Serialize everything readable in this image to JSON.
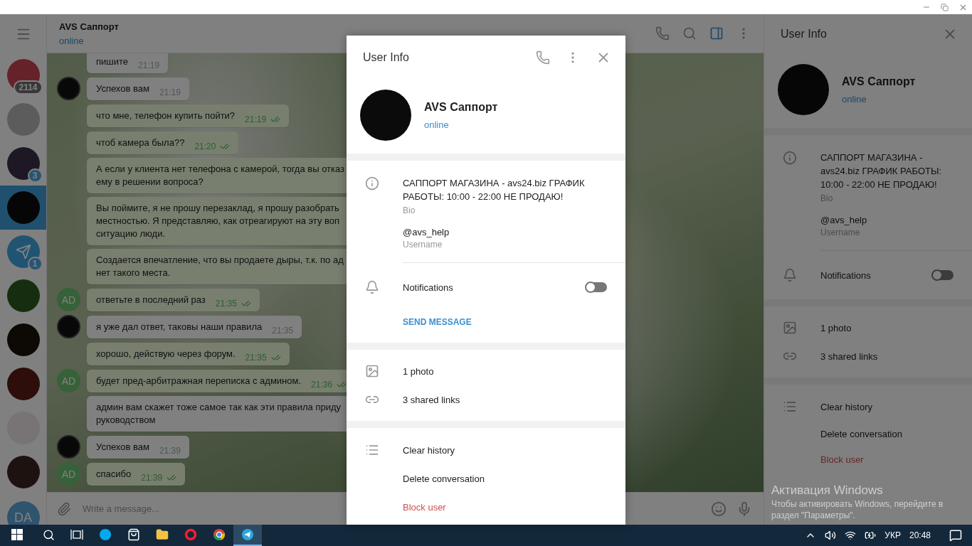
{
  "sidebar": {
    "chats": [
      {
        "kind": "photo",
        "badge": "2114",
        "muted": true,
        "selected": false
      },
      {
        "kind": "photo",
        "selected": false
      },
      {
        "kind": "photo",
        "badge": "3",
        "muted": false,
        "selected": false
      },
      {
        "kind": "photo",
        "selected": true
      },
      {
        "kind": "telegram",
        "badge": "1",
        "muted": false,
        "selected": false
      },
      {
        "kind": "photo",
        "selected": false
      },
      {
        "kind": "photo",
        "selected": false
      },
      {
        "kind": "photo",
        "selected": false
      },
      {
        "kind": "photo",
        "selected": false
      },
      {
        "kind": "photo",
        "selected": false
      }
    ],
    "account": {
      "initials": "DA"
    }
  },
  "chat": {
    "title": "AVS Саппорт",
    "status": "online",
    "header_icons": [
      {
        "kind": "phone",
        "active": false
      },
      {
        "kind": "search",
        "active": false
      },
      {
        "kind": "panel",
        "active": true
      },
      {
        "kind": "more",
        "active": false
      }
    ],
    "messages": [
      {
        "kind": "incoming",
        "lines": [
          "пишите"
        ],
        "time": "21:19"
      },
      {
        "kind": "incoming",
        "avatar": {
          "kind": "photo"
        },
        "lines": [
          "Успехов вам"
        ],
        "time": "21:19"
      },
      {
        "kind": "outgoing",
        "lines": [
          "что мне, телефон купить пойти?"
        ],
        "time": "21:19",
        "read": true
      },
      {
        "kind": "outgoing",
        "lines": [
          "чтоб камера была??"
        ],
        "time": "21:20",
        "read": true
      },
      {
        "kind": "outgoing",
        "lines": [
          "А если у клиента нет телефона с камерой, тогда вы отказ",
          "ему в решении вопроса?"
        ]
      },
      {
        "kind": "outgoing",
        "lines": [
          "Вы поймите, я не прошу перезаклад, я прошу разобрать",
          "местностью. Я представляю, как отреагируют на эту воп",
          "ситуацию люди."
        ]
      },
      {
        "kind": "outgoing",
        "lines": [
          "Создается впечатление, что вы продаете дыры, т.к. по ад",
          "нет такого места."
        ]
      },
      {
        "kind": "outgoing",
        "avatar": {
          "kind": "initials",
          "text": "AD"
        },
        "lines": [
          "ответьте в последний раз"
        ],
        "time": "21:35",
        "read": true
      },
      {
        "kind": "incoming",
        "avatar": {
          "kind": "photo"
        },
        "lines": [
          "я уже дал ответ, таковы наши правила"
        ],
        "time": "21:35"
      },
      {
        "kind": "outgoing",
        "lines": [
          "хорошо, действую через форум."
        ],
        "time": "21:35",
        "read": true
      },
      {
        "kind": "outgoing",
        "avatar": {
          "kind": "initials",
          "text": "AD"
        },
        "lines": [
          "будет пред-арбитражная переписка с админом."
        ],
        "time": "21:36",
        "read": true
      },
      {
        "kind": "incoming",
        "lines": [
          "админ вам скажет тоже самое так как эти правила приду",
          "руководством"
        ]
      },
      {
        "kind": "incoming",
        "avatar": {
          "kind": "photo"
        },
        "lines": [
          "Успехов вам"
        ],
        "time": "21:39"
      },
      {
        "kind": "outgoing",
        "avatar": {
          "kind": "initials",
          "text": "AD"
        },
        "lines": [
          "спасибо"
        ],
        "time": "21:39",
        "read": true
      }
    ],
    "input": {
      "placeholder": "Write a message..."
    }
  },
  "user_info_panel": {
    "title": "User Info",
    "header_icons": [
      {
        "kind": "close"
      }
    ],
    "name": "AVS Саппорт",
    "status": "online",
    "bio": "САППОРТ МАГАЗИНА - avs24.biz ГРАФИК РАБОТЫ: 10:00 - 22:00 НЕ ПРОДАЮ!",
    "bio_label": "Bio",
    "username": "@avs_help",
    "username_label": "Username",
    "notifications": {
      "label": "Notifications",
      "on": false
    },
    "media": [
      {
        "kind": "photo",
        "label": "1 photo"
      },
      {
        "kind": "links",
        "label": "3 shared links"
      }
    ],
    "actions": [
      {
        "kind": "list",
        "label": "Clear history"
      },
      {
        "kind": "plain",
        "label": "Delete conversation"
      },
      {
        "kind": "danger",
        "label": "Block user"
      }
    ]
  },
  "user_info_modal": {
    "title": "User Info",
    "header_icons": [
      {
        "kind": "phone"
      },
      {
        "kind": "more"
      },
      {
        "kind": "close"
      }
    ],
    "name": "AVS Саппорт",
    "status": "online",
    "bio": "САППОРТ МАГАЗИНА - avs24.biz ГРАФИК РАБОТЫ: 10:00 - 22:00 НЕ ПРОДАЮ!",
    "bio_label": "Bio",
    "username": "@avs_help",
    "username_label": "Username",
    "notifications": {
      "label": "Notifications",
      "on": false
    },
    "send_message": "SEND MESSAGE",
    "media": [
      {
        "kind": "photo",
        "label": "1 photo"
      },
      {
        "kind": "links",
        "label": "3 shared links"
      }
    ],
    "actions": [
      {
        "kind": "list",
        "label": "Clear history"
      },
      {
        "kind": "plain",
        "label": "Delete conversation"
      },
      {
        "kind": "danger",
        "label": "Block user"
      }
    ]
  },
  "activation_notice": {
    "title": "Активация Windows",
    "text": "Чтобы активировать Windows, перейдите в раздел \"Параметры\"."
  },
  "taskbar": {
    "apps": [
      {
        "kind": "skype",
        "active": false
      },
      {
        "kind": "store",
        "active": false
      },
      {
        "kind": "explorer",
        "active": false
      },
      {
        "kind": "opera",
        "active": false
      },
      {
        "kind": "chrome",
        "active": false
      },
      {
        "kind": "telegram",
        "active": true
      }
    ],
    "language": "УКР",
    "time": "20:48"
  }
}
